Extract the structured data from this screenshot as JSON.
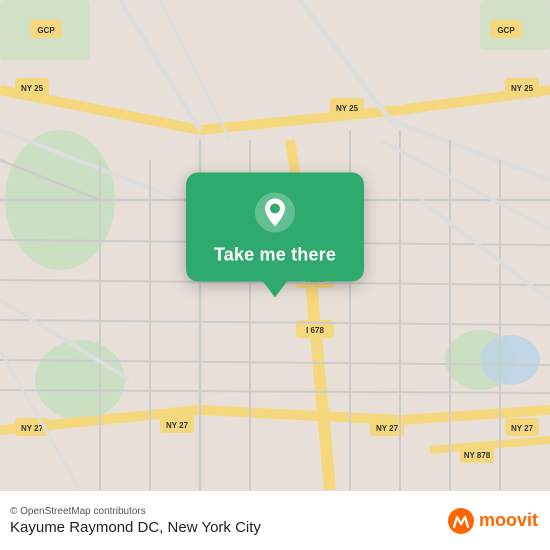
{
  "map": {
    "alt": "Street map of Queens/New York area"
  },
  "popup": {
    "button_label": "Take me there",
    "icon": "location-pin"
  },
  "bottom_bar": {
    "copyright": "© OpenStreetMap contributors",
    "location_name": "Kayume Raymond DC, New York City",
    "logo_text": "moovit"
  }
}
